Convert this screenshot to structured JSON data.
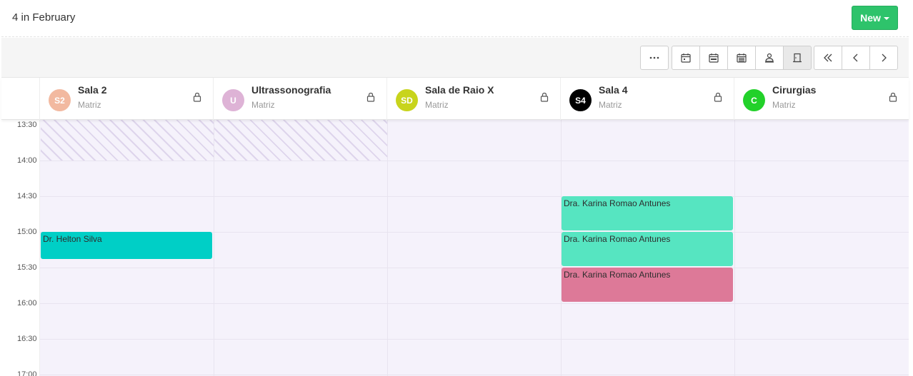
{
  "header": {
    "title": "4 in February",
    "new_button": "New"
  },
  "toolbar": {
    "buttons": [
      {
        "name": "more-options-button",
        "icon": "ellipsis-icon"
      },
      {
        "name": "day-view-button",
        "icon": "calendar-day-icon"
      },
      {
        "name": "week-view-button",
        "icon": "calendar-week-icon"
      },
      {
        "name": "month-view-button",
        "icon": "calendar-month-icon"
      },
      {
        "name": "professional-view-button",
        "icon": "person-icon"
      },
      {
        "name": "room-view-button",
        "icon": "door-icon"
      },
      {
        "name": "today-button",
        "icon": "double-chevron-left-icon"
      },
      {
        "name": "prev-button",
        "icon": "chevron-left-icon"
      },
      {
        "name": "next-button",
        "icon": "chevron-right-icon"
      }
    ]
  },
  "resources": [
    {
      "initials": "S2",
      "name": "Sala 2",
      "sub": "Matriz",
      "color": "#f2b9a0"
    },
    {
      "initials": "U",
      "name": "Ultrassonografia",
      "sub": "Matriz",
      "color": "#deb3d6"
    },
    {
      "initials": "SD",
      "name": "Sala de Raio X",
      "sub": "Matriz",
      "color": "#c8d41c"
    },
    {
      "initials": "S4",
      "name": "Sala 4",
      "sub": "Matriz",
      "color": "#000000"
    },
    {
      "initials": "C",
      "name": "Cirurgias",
      "sub": "Matriz",
      "color": "#22d12a"
    }
  ],
  "times": [
    "13:30",
    "14:00",
    "14:30",
    "15:00",
    "15:30",
    "16:00",
    "16:30",
    "17:00"
  ],
  "events": [
    {
      "label": "Dr. Helton Silva",
      "resource": 0,
      "start": "15:00",
      "end": "15:23",
      "color": "#00cfc6"
    },
    {
      "label": "Dra. Karina Romao Antunes",
      "resource": 3,
      "start": "14:30",
      "end": "15:00",
      "color": "#56e5c1"
    },
    {
      "label": "Dra. Karina Romao Antunes",
      "resource": 3,
      "start": "15:00",
      "end": "15:30",
      "color": "#56e5c1"
    },
    {
      "label": "Dra. Karina Romao Antunes",
      "resource": 3,
      "start": "15:30",
      "end": "16:00",
      "color": "#dd7998"
    }
  ],
  "colors": {
    "accent": "#2ec36b",
    "grid_bg": "#f5f2fb"
  }
}
